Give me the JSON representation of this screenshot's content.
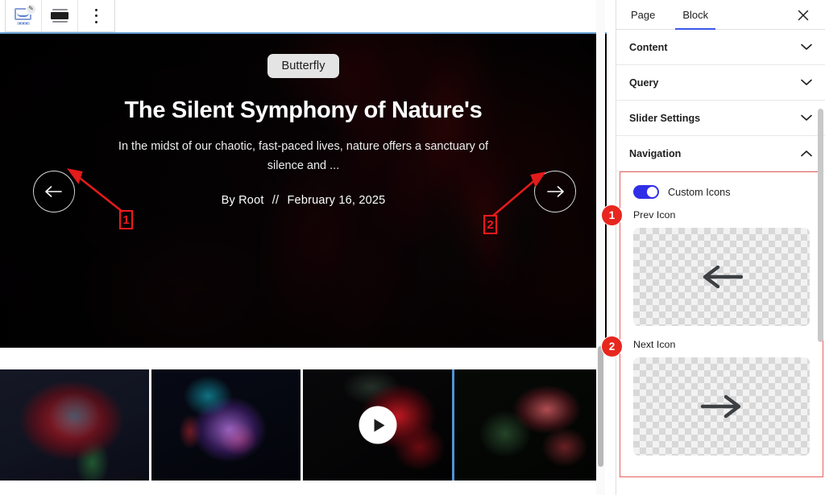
{
  "toolbar": {
    "block_icon": "slider-block-icon",
    "align_icon": "align-icon",
    "options_icon": "kebab-menu-icon",
    "badge": "edit-badge"
  },
  "slide": {
    "tag": "Butterfly",
    "title": "The Silent Symphony of Nature's",
    "excerpt": "In the midst of our chaotic, fast-paced lives, nature offers a sanctuary of silence and ...",
    "author_prefix": "By Root",
    "separator": "//",
    "date": "February 16, 2025",
    "prev_icon": "arrow-left-icon",
    "next_icon": "arrow-right-icon"
  },
  "thumbnails": [
    {
      "name": "thumbnail-1",
      "selected": false,
      "has_video": false
    },
    {
      "name": "thumbnail-2",
      "selected": false,
      "has_video": false
    },
    {
      "name": "thumbnail-3",
      "selected": true,
      "has_video": true
    },
    {
      "name": "thumbnail-4",
      "selected": false,
      "has_video": false
    }
  ],
  "sidebar": {
    "tabs": [
      {
        "label": "Page",
        "active": false
      },
      {
        "label": "Block",
        "active": true
      }
    ],
    "close_icon": "close-icon",
    "panels": [
      {
        "label": "Content",
        "expanded": false,
        "icon": "chevron-down-icon"
      },
      {
        "label": "Query",
        "expanded": false,
        "icon": "chevron-down-icon"
      },
      {
        "label": "Slider Settings",
        "expanded": false,
        "icon": "chevron-down-icon"
      },
      {
        "label": "Navigation",
        "expanded": true,
        "icon": "chevron-up-icon"
      }
    ],
    "navigation": {
      "custom_icons_label": "Custom Icons",
      "custom_icons_enabled": true,
      "prev_icon_label": "Prev Icon",
      "next_icon_label": "Next Icon",
      "prev_icon_preview": "arrow-left-icon",
      "next_icon_preview": "arrow-right-icon"
    }
  },
  "annotations": {
    "markers": [
      {
        "id": "1",
        "kind": "box"
      },
      {
        "id": "2",
        "kind": "box"
      },
      {
        "id": "1",
        "kind": "badge"
      },
      {
        "id": "2",
        "kind": "badge"
      }
    ]
  },
  "colors": {
    "accent_blue": "#3858e9",
    "toggle_on": "#2f2fe8",
    "annotation_red": "#ef1a1a",
    "badge_red": "#e8261e",
    "selection_blue": "#6ba3d6"
  }
}
